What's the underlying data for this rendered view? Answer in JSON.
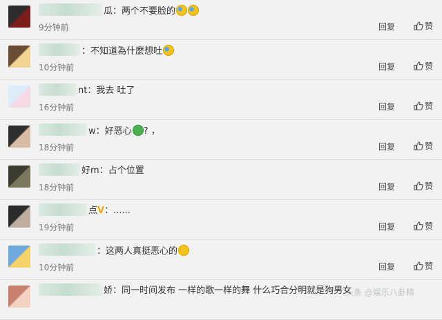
{
  "comments": [
    {
      "text": "两个不要脸的",
      "time": "9分钟前",
      "emoji": [
        "blue-laugh-emoji",
        "blue-laugh-emoji"
      ]
    },
    {
      "text": "不知道為什麼想吐",
      "time": "10分钟前",
      "emoji": [
        "blue-laugh-emoji"
      ]
    },
    {
      "text": "我去 吐了",
      "time": "16分钟前",
      "emoji": []
    },
    {
      "text": "好恶心",
      "suffix": "? ，",
      "time": "18分钟前",
      "emoji": [
        "green-sick-emoji"
      ]
    },
    {
      "text": "占个位置",
      "time": "18分钟前",
      "emoji": []
    },
    {
      "text": "......",
      "time": "19分钟前",
      "emoji": []
    },
    {
      "text": "这两人真挺恶心的",
      "time": "10分钟前",
      "emoji": [
        "heart-eyes-emoji"
      ]
    },
    {
      "text": "同一时间发布 一样的歌一样的舞 什么巧合分明就是狗男女",
      "time": "",
      "emoji": []
    }
  ],
  "reply_label": "回复",
  "like_label": "赞",
  "visible_name_suffixes": [
    "瓜",
    "",
    "nt",
    "w",
    "好m",
    "点",
    "",
    "娇"
  ],
  "verified_mark": "V",
  "watermark": "头条 @娱乐八卦精"
}
